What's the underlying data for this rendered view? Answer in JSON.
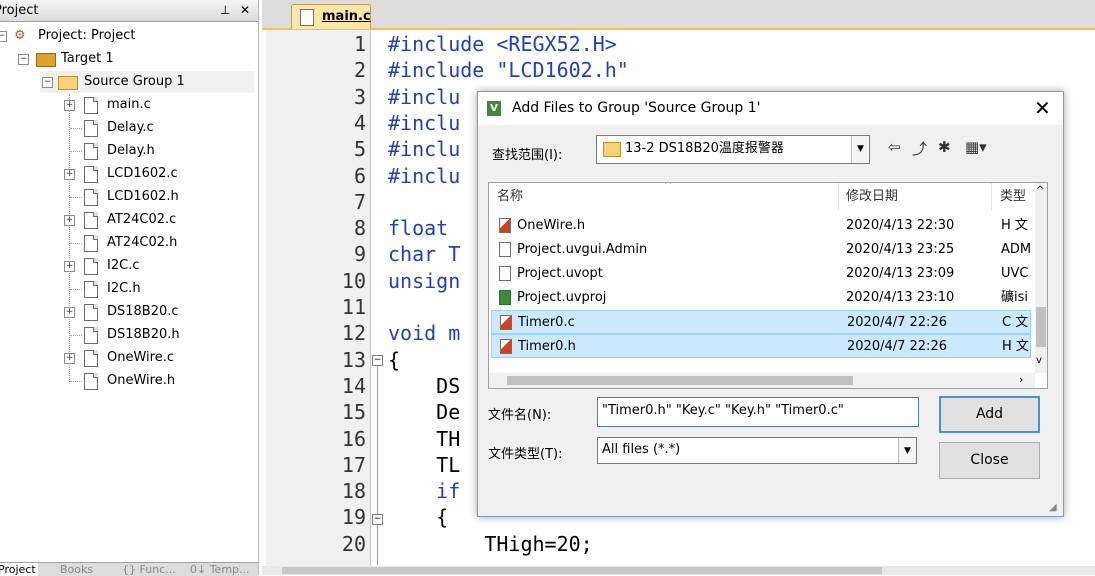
{
  "project_panel": {
    "title": "Project",
    "pin": "⊥",
    "close": "✕",
    "tree": {
      "root": "Project: Project",
      "target": "Target 1",
      "group": "Source Group 1",
      "files": [
        "main.c",
        "Delay.c",
        "Delay.h",
        "LCD1602.c",
        "LCD1602.h",
        "AT24C02.c",
        "AT24C02.h",
        "I2C.c",
        "I2C.h",
        "DS18B20.c",
        "DS18B20.h",
        "OneWire.c",
        "OneWire.h"
      ]
    },
    "bottom_tabs": [
      "Project",
      "Books",
      "{} Func...",
      "0↓ Temp..."
    ]
  },
  "editor": {
    "active_tab": "main.c",
    "lines": [
      {
        "n": "1",
        "text": "#include <REGX52.H>"
      },
      {
        "n": "2",
        "text": "#include \"LCD1602.h\""
      },
      {
        "n": "3",
        "text": "#inclu"
      },
      {
        "n": "4",
        "text": "#inclu"
      },
      {
        "n": "5",
        "text": "#inclu"
      },
      {
        "n": "6",
        "text": "#inclu"
      },
      {
        "n": "7",
        "text": ""
      },
      {
        "n": "8",
        "text": "float"
      },
      {
        "n": "9",
        "text": "char T"
      },
      {
        "n": "10",
        "text": "unsign"
      },
      {
        "n": "11",
        "text": ""
      },
      {
        "n": "12",
        "text": "void m"
      },
      {
        "n": "13",
        "text": "{"
      },
      {
        "n": "14",
        "text": "    DS"
      },
      {
        "n": "15",
        "text": "    De"
      },
      {
        "n": "16",
        "text": "    TH"
      },
      {
        "n": "17",
        "text": "    TL"
      },
      {
        "n": "18",
        "text": "    if"
      },
      {
        "n": "19",
        "text": "    {"
      },
      {
        "n": "20",
        "text": "        THigh=20;"
      }
    ]
  },
  "dialog": {
    "title": "Add Files to Group 'Source Group 1'",
    "look_in_label": "查找范围(I):",
    "look_in_value": "13-2 DS18B20温度报警器",
    "columns": {
      "name": "名称",
      "date": "修改日期",
      "type": "类型"
    },
    "files": [
      {
        "name": "OneWire.h",
        "date": "2020/4/13 22:30",
        "type": "H 文",
        "icon": "c",
        "selected": false
      },
      {
        "name": "Project.uvgui.Admin",
        "date": "2020/4/13 23:25",
        "type": "ADM",
        "icon": "doc",
        "selected": false
      },
      {
        "name": "Project.uvopt",
        "date": "2020/4/13 23:09",
        "type": "UVC",
        "icon": "doc",
        "selected": false
      },
      {
        "name": "Project.uvproj",
        "date": "2020/4/13 23:10",
        "type": "礦isi",
        "icon": "v",
        "selected": false
      },
      {
        "name": "Timer0.c",
        "date": "2020/4/7 22:26",
        "type": "C 文",
        "icon": "c",
        "selected": true
      },
      {
        "name": "Timer0.h",
        "date": "2020/4/7 22:26",
        "type": "H 文",
        "icon": "c",
        "selected": true
      }
    ],
    "filename_label": "文件名(N):",
    "filename_value": "\"Timer0.h\" \"Key.c\" \"Key.h\" \"Timer0.c\"",
    "filetype_label": "文件类型(T):",
    "filetype_value": "All files (*.*)",
    "add_button": "Add",
    "close_button": "Close"
  }
}
